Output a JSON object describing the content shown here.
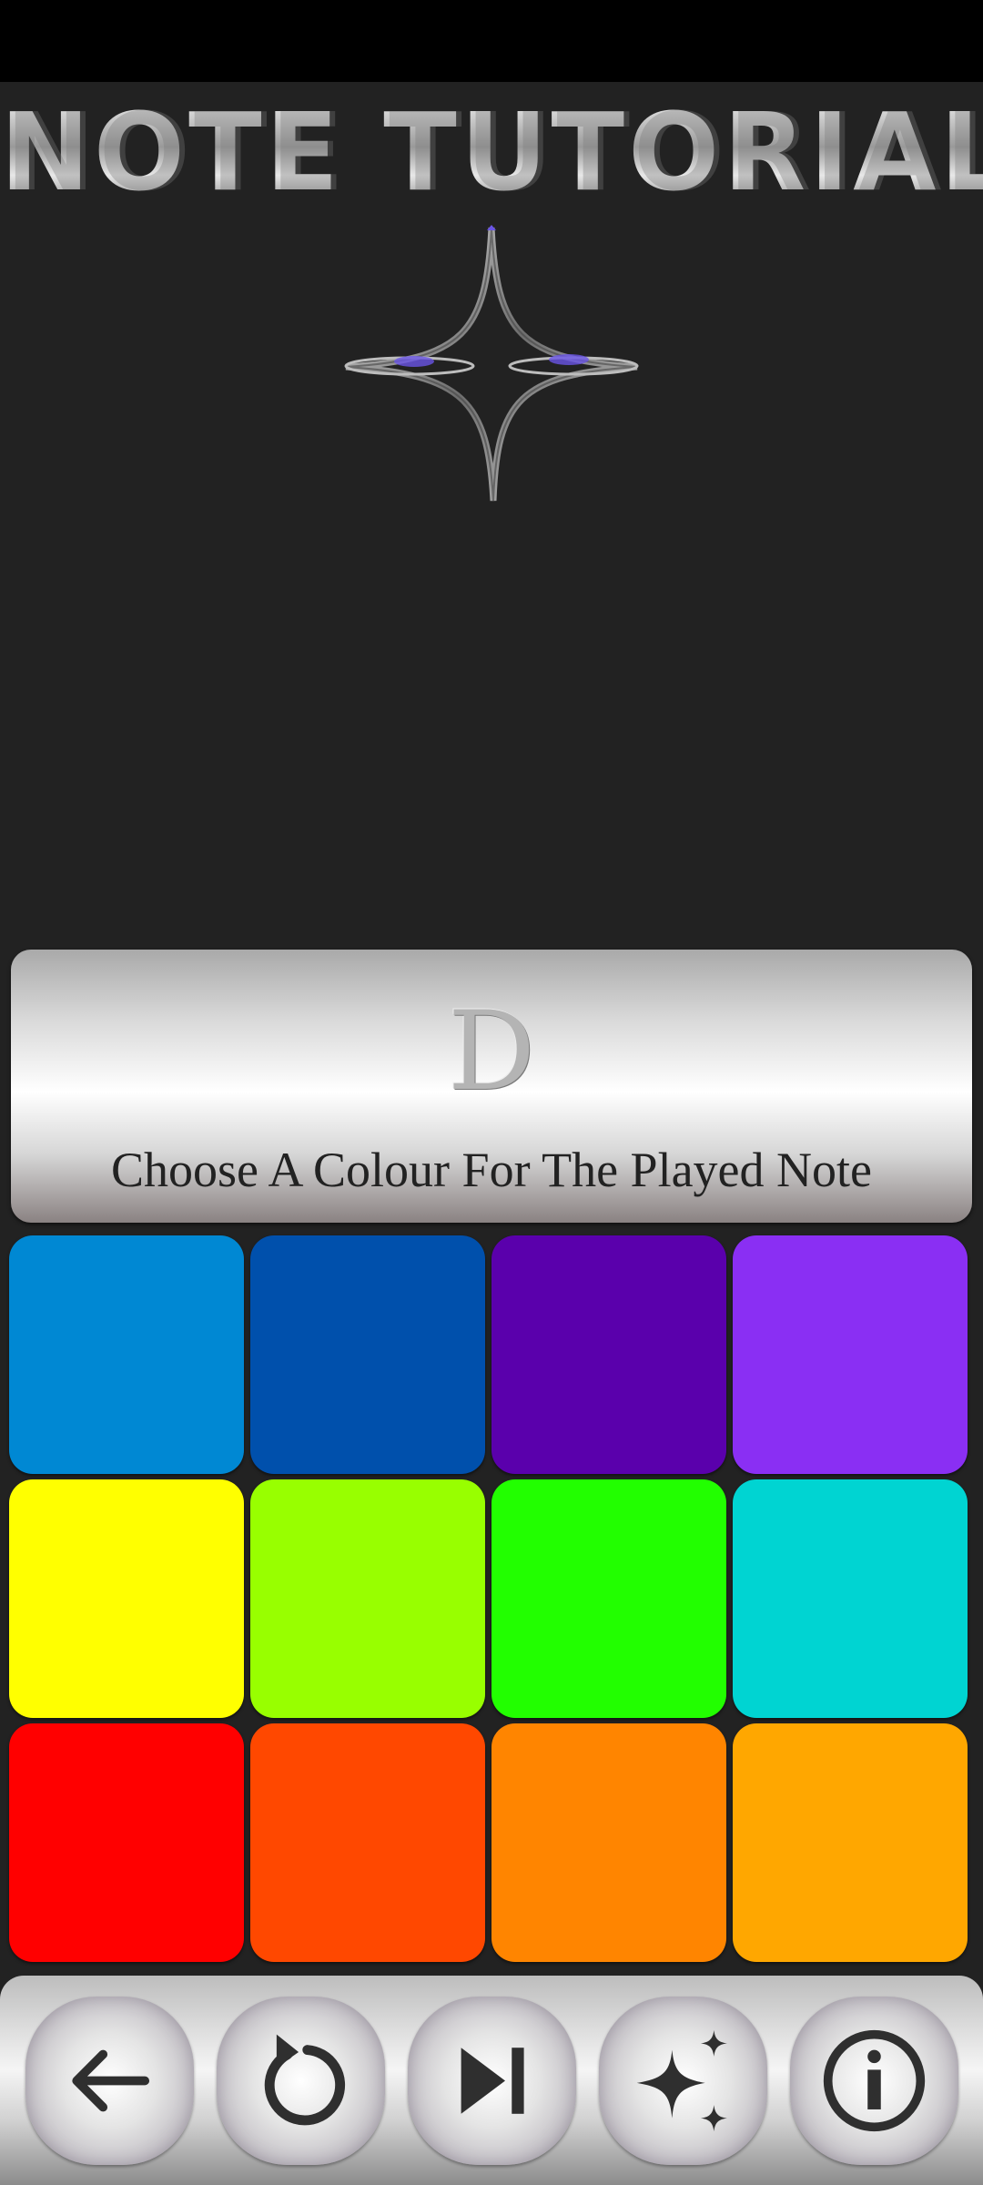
{
  "header": {
    "title": "NOTE TUTORIAL"
  },
  "prompt": {
    "note": "D",
    "instruction": "Choose A Colour For The Played Note"
  },
  "palette": {
    "swatches": [
      "#0088d3",
      "#0050ac",
      "#5a00ac",
      "#8a2ff3",
      "#ffff00",
      "#98ff00",
      "#22ff00",
      "#00d4d2",
      "#ff0000",
      "#ff4800",
      "#ff8500",
      "#ffa700"
    ]
  },
  "toolbar": {
    "buttons": [
      {
        "icon": "back-arrow-icon"
      },
      {
        "icon": "replay-icon"
      },
      {
        "icon": "skip-next-icon"
      },
      {
        "icon": "sparkles-icon"
      },
      {
        "icon": "info-icon"
      }
    ]
  },
  "colors": {
    "background": "#222222",
    "icon": "#2f2f2f",
    "sparkle_accent": "#6a55e6"
  }
}
